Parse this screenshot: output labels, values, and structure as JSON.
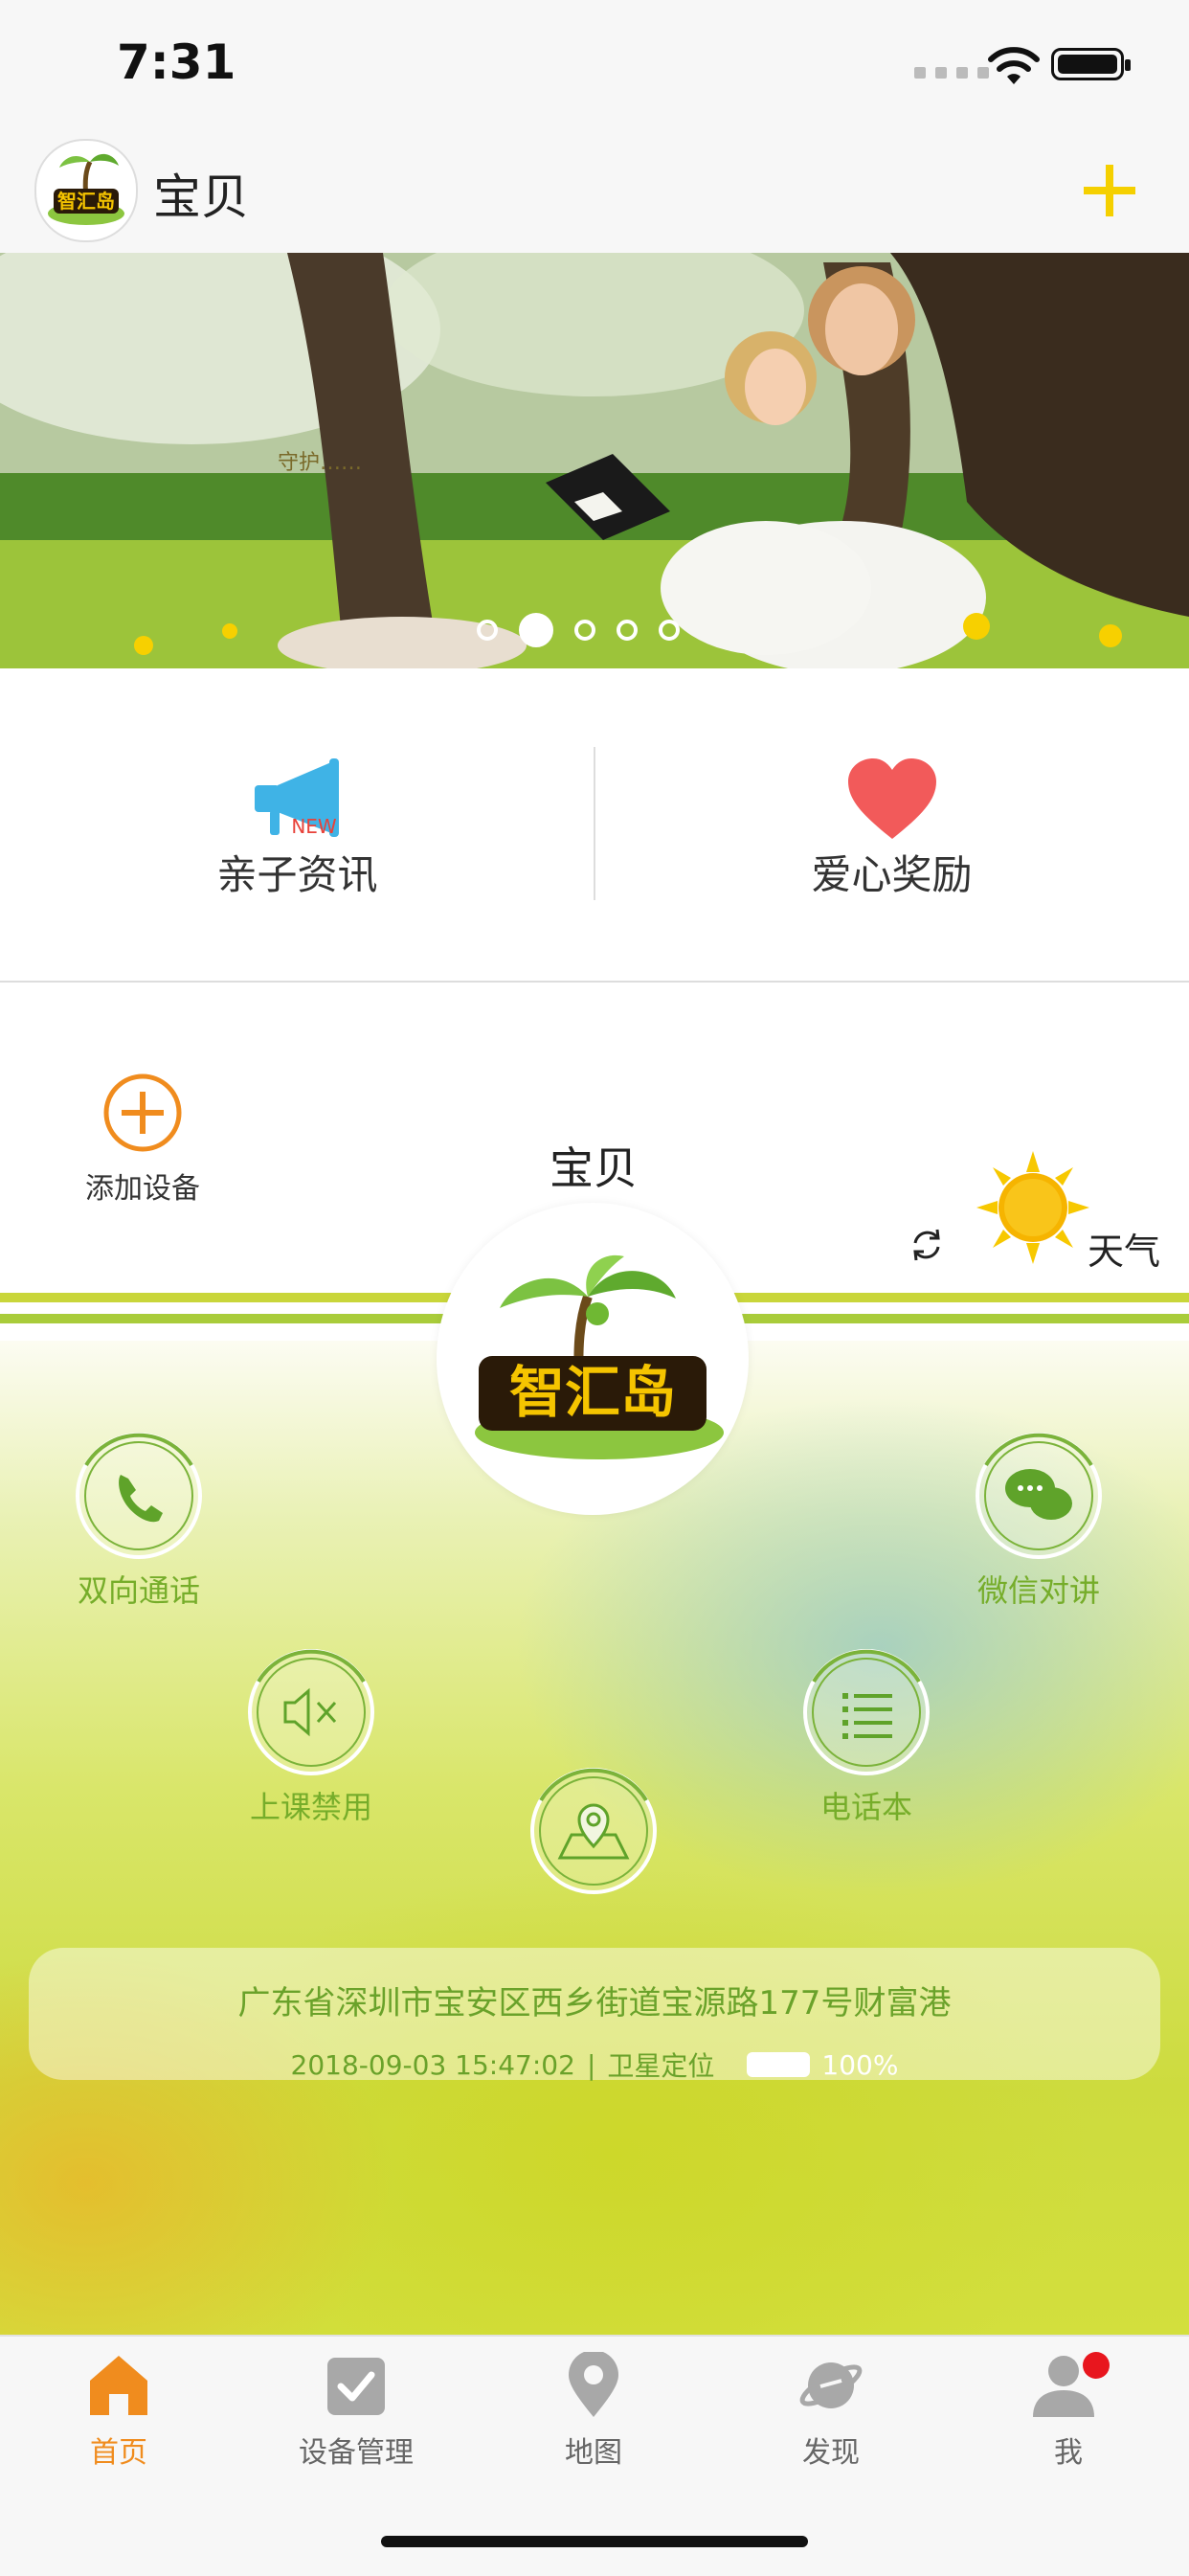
{
  "status_bar": {
    "time": "7:31"
  },
  "header": {
    "title": "宝贝",
    "logo_text": "智汇岛"
  },
  "banner": {
    "caption": "守护……",
    "dots": 5,
    "active_dot": 1
  },
  "shortcuts": [
    {
      "label": "亲子资讯",
      "icon": "megaphone-icon",
      "badge": "NEW"
    },
    {
      "label": "爱心奖励",
      "icon": "heart-icon"
    }
  ],
  "device": {
    "add_device_label": "添加设备",
    "name": "宝贝",
    "weather_label": "天气",
    "logo_text": "智汇岛",
    "functions": {
      "call": "双向通话",
      "wechat": "微信对讲",
      "class_mute": "上课禁用",
      "phonebook": "电话本"
    },
    "location": {
      "address": "广东省深圳市宝安区西乡街道宝源路177号财富港",
      "timestamp": "2018-09-03 15:47:02",
      "separator": "|",
      "method": "卫星定位",
      "battery": "100%"
    }
  },
  "tabbar": {
    "items": [
      {
        "label": "首页",
        "icon": "home-icon",
        "active": true
      },
      {
        "label": "设备管理",
        "icon": "checkbox-icon",
        "active": false
      },
      {
        "label": "地图",
        "icon": "map-pin-icon",
        "active": false
      },
      {
        "label": "发现",
        "icon": "planet-icon",
        "active": false
      },
      {
        "label": "我",
        "icon": "user-icon",
        "active": false,
        "badge": true
      }
    ]
  },
  "colors": {
    "accent": "#f08c1e",
    "add_plus": "#f5d000",
    "green_text": "#6aa22a",
    "heart": "#f25a5a",
    "megaphone": "#3fb3e6"
  }
}
